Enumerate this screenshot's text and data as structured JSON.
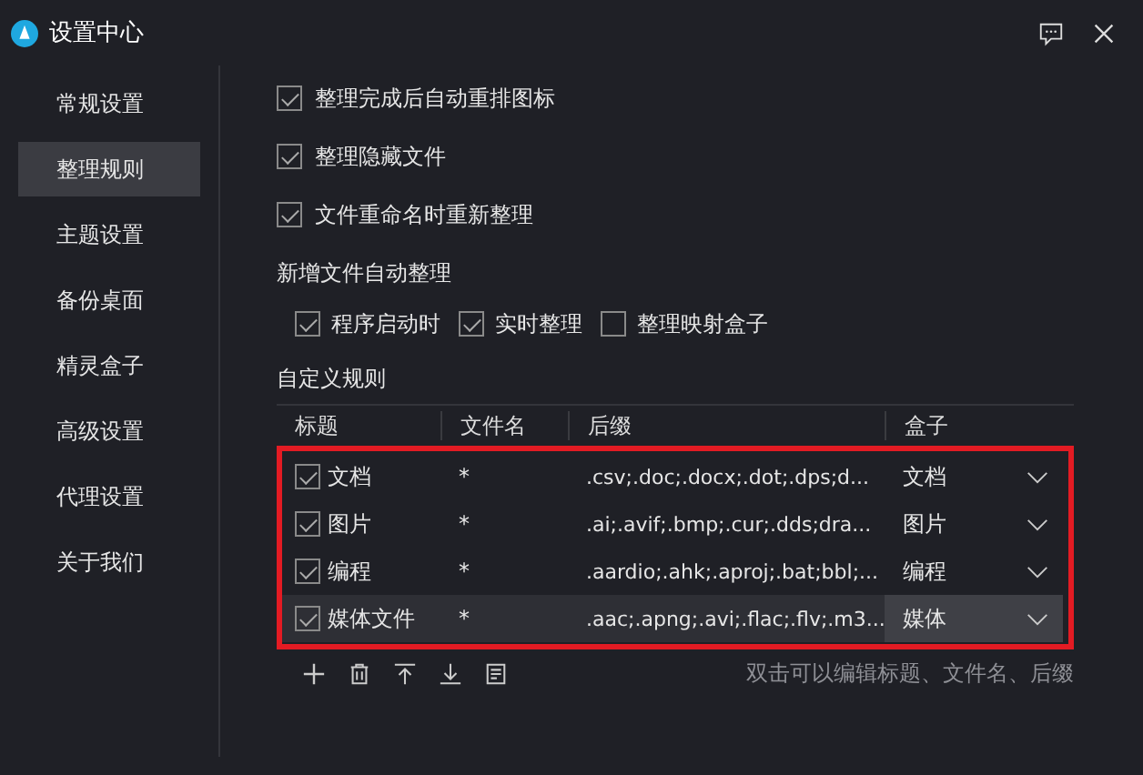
{
  "window": {
    "title": "设置中心"
  },
  "sidebar": {
    "items": [
      {
        "label": "常规设置",
        "selected": false
      },
      {
        "label": "整理规则",
        "selected": true
      },
      {
        "label": "主题设置",
        "selected": false
      },
      {
        "label": "备份桌面",
        "selected": false
      },
      {
        "label": "精灵盒子",
        "selected": false
      },
      {
        "label": "高级设置",
        "selected": false
      },
      {
        "label": "代理设置",
        "selected": false
      },
      {
        "label": "关于我们",
        "selected": false
      }
    ]
  },
  "options": [
    {
      "label": "整理完成后自动重排图标",
      "checked": true
    },
    {
      "label": "整理隐藏文件",
      "checked": true
    },
    {
      "label": "文件重命名时重新整理",
      "checked": true
    }
  ],
  "auto_section": {
    "title": "新增文件自动整理",
    "options": [
      {
        "label": "程序启动时",
        "checked": true
      },
      {
        "label": "实时整理",
        "checked": true
      },
      {
        "label": "整理映射盒子",
        "checked": false
      }
    ]
  },
  "rules": {
    "title": "自定义规则",
    "columns": [
      "标题",
      "文件名",
      "后缀",
      "盒子"
    ],
    "rows": [
      {
        "checked": true,
        "title": "文档",
        "filename": "*",
        "suffix": ".csv;.doc;.docx;.dot;.dps;d...",
        "box": "文档",
        "selected": false
      },
      {
        "checked": true,
        "title": "图片",
        "filename": "*",
        "suffix": ".ai;.avif;.bmp;.cur;.dds;dra...",
        "box": "图片",
        "selected": false
      },
      {
        "checked": true,
        "title": "编程",
        "filename": "*",
        "suffix": ".aardio;.ahk;.aproj;.bat;bbl;...",
        "box": "编程",
        "selected": false
      },
      {
        "checked": true,
        "title": "媒体文件",
        "filename": "*",
        "suffix": ".aac;.apng;.avi;.flac;.flv;.m3...",
        "box": "媒体",
        "selected": true
      }
    ],
    "hint": "双击可以编辑标题、文件名、后缀"
  }
}
